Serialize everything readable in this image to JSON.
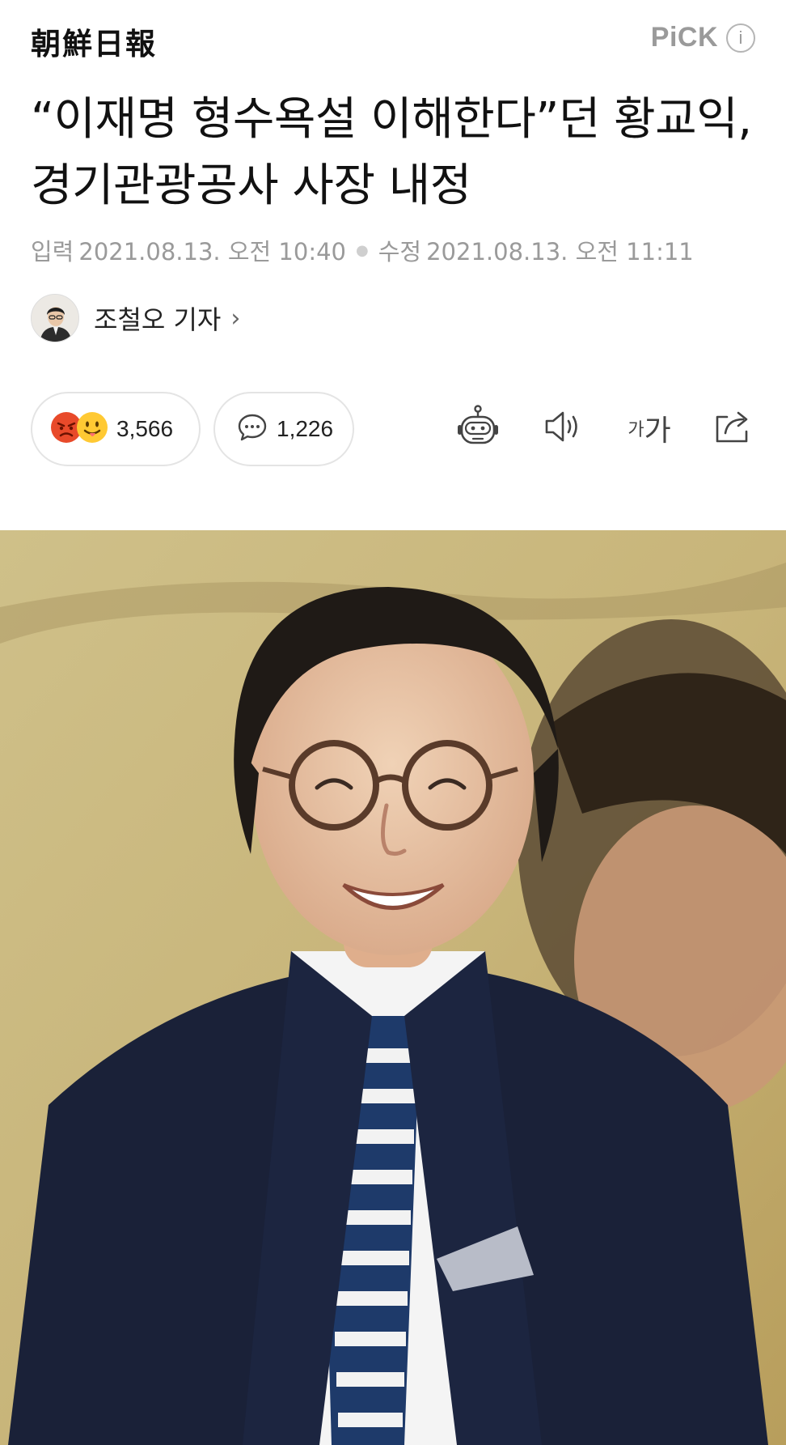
{
  "header": {
    "press_name": "朝鮮日報",
    "pick_label": "PiCK",
    "info_icon_label": "i"
  },
  "article": {
    "headline": "“이재명 형수욕설 이해한다”던 황교익, 경기관광공사 사장 내정",
    "published_label": "입력",
    "published": "2021.08.13. 오전 10:40",
    "modified_label": "수정",
    "modified": "2021.08.13. 오전 11:11"
  },
  "reporter": {
    "name": "조철오 기자",
    "chevron": "›"
  },
  "actions": {
    "reaction_count": "3,566",
    "comment_count": "1,226",
    "font_small": "가",
    "font_large": "가"
  },
  "icons": {
    "angry_emoji": "angry-face-icon",
    "tongue_emoji": "tongue-face-icon",
    "comment": "speech-bubble-icon",
    "summary_bot": "robot-icon",
    "tts": "speaker-icon",
    "share": "share-icon"
  },
  "colors": {
    "meta_gray": "#9a9a9a",
    "pill_border": "#e4e4e4",
    "angry_red": "#e84a2a",
    "tongue_yellow": "#ffc933"
  }
}
